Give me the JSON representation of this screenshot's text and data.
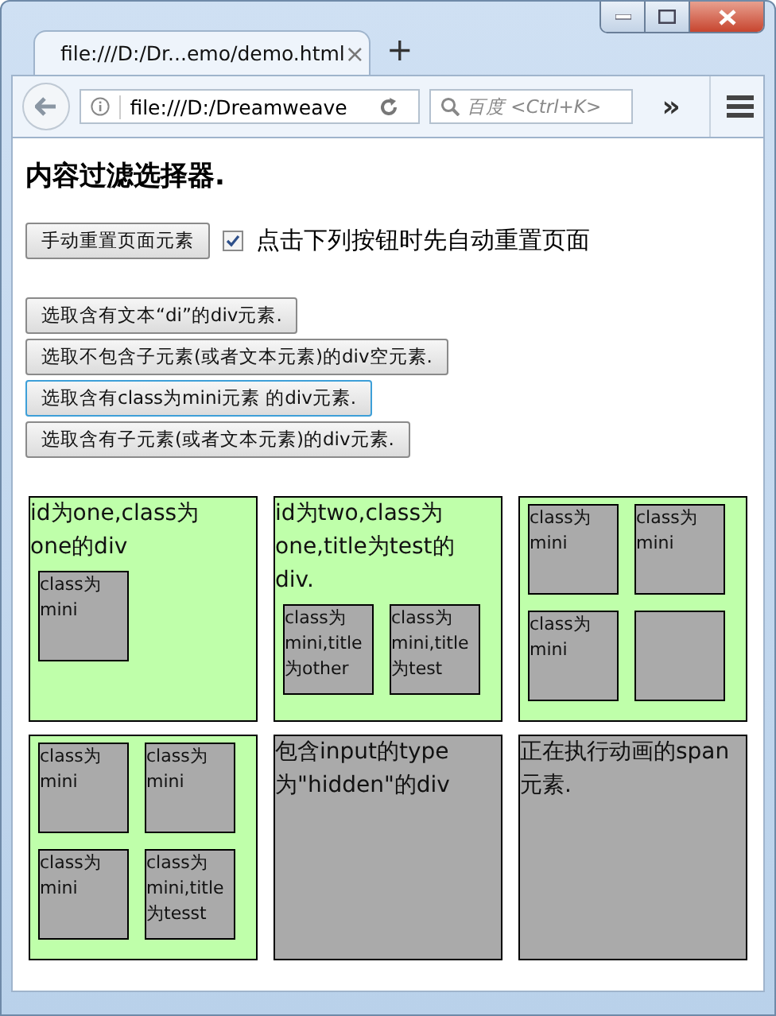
{
  "browser": {
    "tab_title": "file:///D:/Dr...emo/demo.html",
    "tab_close": "×",
    "new_tab": "+",
    "url": "file:///D:/Dreamweave",
    "search_placeholder": "百度 <Ctrl+K>",
    "overflow": "»"
  },
  "page": {
    "heading": "内容过滤选择器.",
    "reset_button": "手动重置页面元素",
    "auto_reset": {
      "label": "点击下列按钮时先自动重置页面",
      "checked": true
    },
    "actions": [
      {
        "label": "选取含有文本“di”的div元素.",
        "focused": false
      },
      {
        "label": "选取不包含子元素(或者文本元素)的div空元素.",
        "focused": false
      },
      {
        "label": "选取含有class为mini元素 的div元素.",
        "focused": true
      },
      {
        "label": "选取含有子元素(或者文本元素)的div元素.",
        "focused": false
      }
    ],
    "boxes": [
      {
        "kind": "green",
        "text": "id为one,class为one的div",
        "minis": [
          {
            "kind": "labeled",
            "text": "class为mini"
          }
        ]
      },
      {
        "kind": "green",
        "text": "id为two,class为one,title为test的div.",
        "minis": [
          {
            "kind": "labeled",
            "text": "class为mini,title为other"
          },
          {
            "kind": "labeled",
            "text": "class为mini,title为test"
          }
        ]
      },
      {
        "kind": "green",
        "minis": [
          {
            "kind": "labeled",
            "text": "class为mini"
          },
          {
            "kind": "labeled",
            "text": "class为mini"
          },
          {
            "kind": "labeled",
            "text": "class为mini"
          },
          {
            "kind": "blank"
          }
        ]
      },
      {
        "kind": "green",
        "minis": [
          {
            "kind": "labeled",
            "text": "class为mini"
          },
          {
            "kind": "labeled",
            "text": "class为mini"
          },
          {
            "kind": "labeled",
            "text": "class为mini"
          },
          {
            "kind": "labeled",
            "text": "class为mini,title为tesst"
          }
        ]
      },
      {
        "kind": "gray",
        "text": "包含input的type为\"hidden\"的div"
      },
      {
        "kind": "gray",
        "text": "正在执行动画的span元素."
      }
    ]
  }
}
